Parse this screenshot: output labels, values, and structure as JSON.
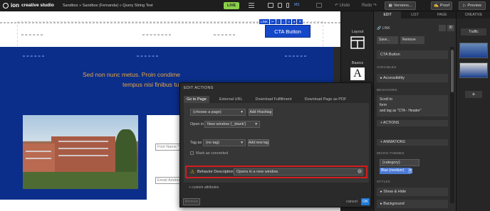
{
  "topbar": {
    "brand": "creative studio",
    "breadcrumb": "Sandbox » Sandbox (Fernanda) » Query String Test",
    "status": "LIVE",
    "device_label": "MS",
    "undo": "Undo",
    "redo": "Redo",
    "versions": "Versions...",
    "proof": "Proof",
    "preview": "Preview"
  },
  "canvas": {
    "headline_line1": "Sed non nunc metus. Proin condime",
    "headline_line2": "tempus nisi finibus tur",
    "cta_label": "CTA Button",
    "link_toolbar": [
      "LINK",
      "✂",
      "↑",
      "↓",
      "≡",
      "⌖",
      "✕"
    ],
    "fields": [
      "First Name *",
      "Email Addres"
    ]
  },
  "elements_bar": {
    "layout": "Layout",
    "basics": "Basics"
  },
  "right_panel": {
    "tabs": [
      "EDIT",
      "LIST",
      "PAGE"
    ],
    "link_label": "LINK",
    "save": "Save...",
    "remove": "Remove",
    "element_name": "CTA Button",
    "variables_header": "VARIABLES",
    "accessibility": "Accessibility",
    "behaviors_header": "BEHAVIORS",
    "behavior_lines": [
      "Scroll to",
      "form",
      "and tag as \"CTA - Header\""
    ],
    "actions": "+ ACTIONS",
    "animations": "+ ANIMATIONS",
    "microthemes_header": "MICRO-THEMES",
    "category_select": "(category)",
    "theme_value": "Blue (medium)",
    "styles_header": "STYLES",
    "show_hide": "Show & Hide",
    "background": "Background"
  },
  "creative_panel": {
    "title": "CREATIVE",
    "traffic": "Traffic",
    "add": "+"
  },
  "dialog": {
    "title": "EDIT ACTIONS",
    "tabs": [
      "Go to Page",
      "External URL",
      "Download Fulfillment",
      "Download Page as PDF"
    ],
    "page_select": "(choose a page)",
    "add_hashtag": "Add #hashtag",
    "open_in_label": "Open in",
    "open_in_value": "New window ('_blank')",
    "tag_as_label": "Tag as",
    "tag_value": "(no tag)",
    "add_new_tag": "Add new tag",
    "mark_converted": "Mark as converted",
    "behavior_description_label": "Behavior Description",
    "behavior_description_value": "Opens in a new window.",
    "custom_attributes": "+ custom attributes",
    "remove": "Remove",
    "cancel": "cancel",
    "ok": "OK"
  },
  "colors": {
    "accent": "#1547c9",
    "live": "#8bd04a",
    "highlight": "#d41c1c",
    "headline": "#e8a642"
  }
}
